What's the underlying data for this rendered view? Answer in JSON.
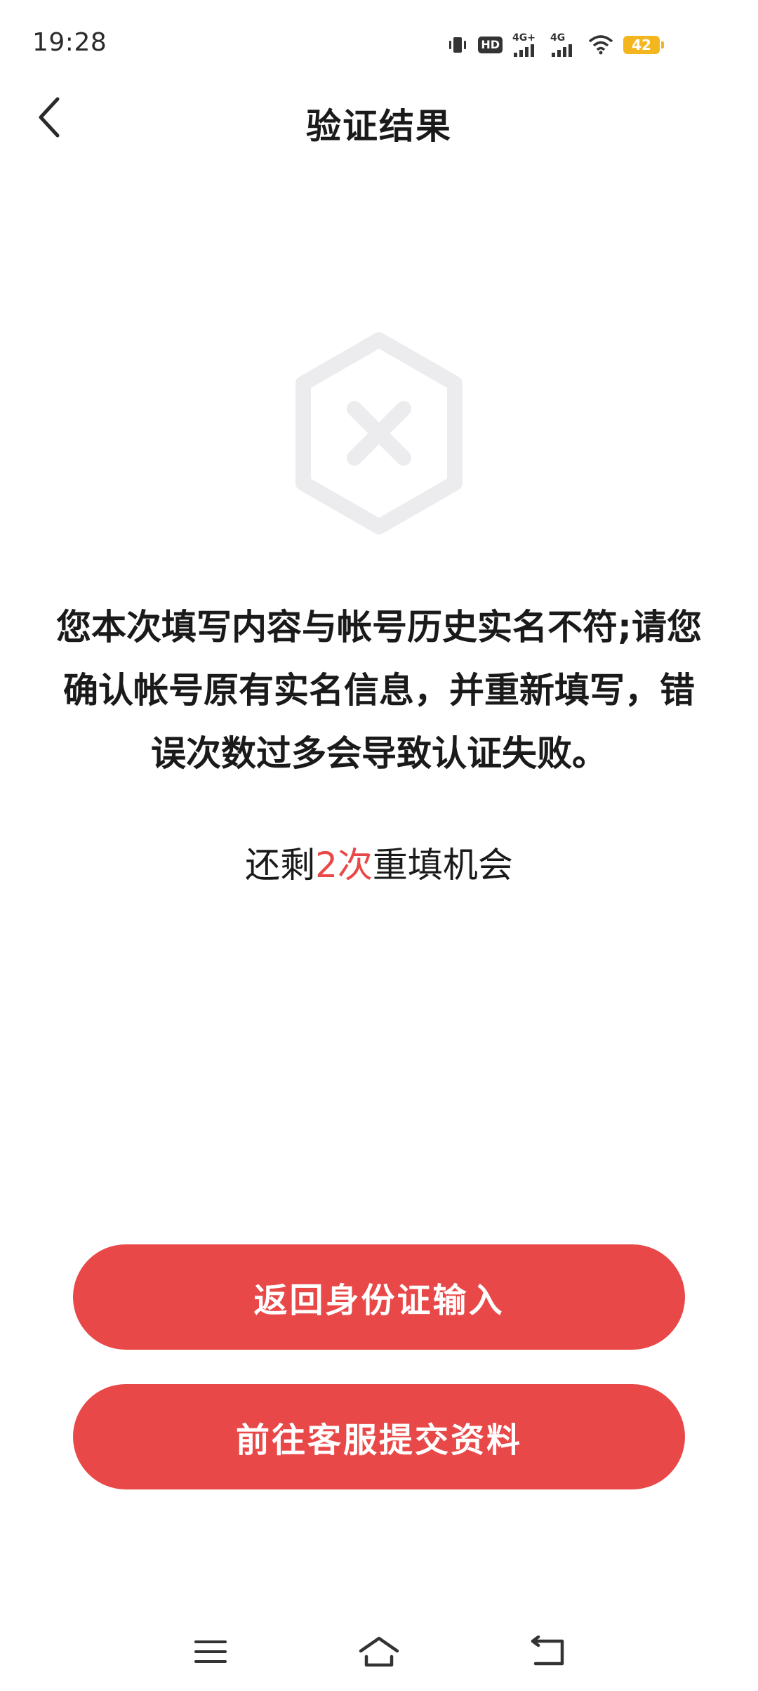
{
  "status_bar": {
    "time": "19:28",
    "hd_label": "HD",
    "net1_label": "4G+",
    "net2_label": "4G",
    "battery_level": "42",
    "icons": [
      "vibrate-icon",
      "hd-icon",
      "signal-4g-plus-icon",
      "signal-4g-icon",
      "wifi-icon",
      "battery-icon"
    ]
  },
  "header": {
    "title": "验证结果",
    "back_icon": "chevron-left-icon"
  },
  "result": {
    "icon": "hexagon-x-icon",
    "message": "您本次填写内容与帐号历史实名不符;请您确认帐号原有实名信息，并重新填写，错误次数过多会导致认证失败。",
    "remaining_prefix": "还剩",
    "remaining_count": "2次",
    "remaining_suffix": "重填机会"
  },
  "actions": {
    "back_to_id_input": "返回身份证输入",
    "go_to_support": "前往客服提交资料"
  },
  "navigation": {
    "icons": [
      "menu-icon",
      "home-icon",
      "back-icon"
    ]
  },
  "colors": {
    "accent": "#e94848",
    "icon_gray": "#ececee",
    "battery": "#f3b61f",
    "text": "#1a1a1a"
  }
}
